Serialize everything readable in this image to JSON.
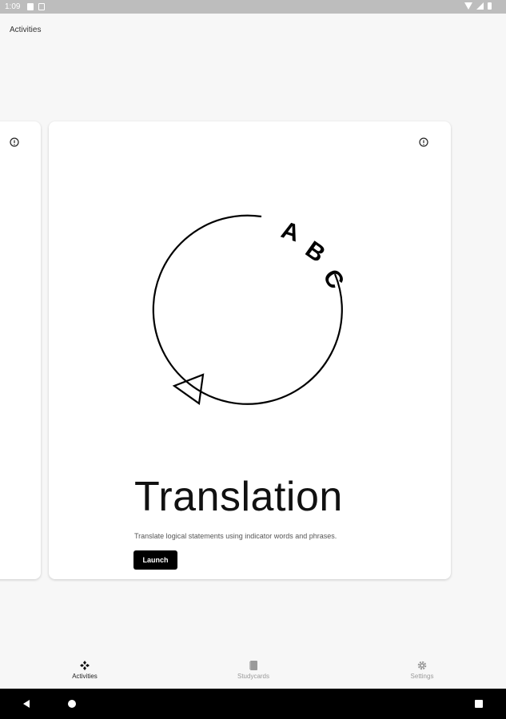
{
  "status_bar": {
    "time": "1:09"
  },
  "header": {
    "title": "Activities"
  },
  "activity": {
    "title": "Translation",
    "description": "Translate logical statements using indicator words and phrases.",
    "launch_label": "Launch",
    "illustration_text": [
      "A",
      "B",
      "C"
    ]
  },
  "bottom_nav": {
    "items": [
      {
        "label": "Activities",
        "icon": "activities-icon",
        "active": true
      },
      {
        "label": "Studycards",
        "icon": "studycards-icon",
        "active": false
      },
      {
        "label": "Settings",
        "icon": "gear-icon",
        "active": false
      }
    ]
  },
  "system_nav": {
    "buttons": [
      "back-icon",
      "home-icon",
      "recents-icon"
    ]
  },
  "colors": {
    "background": "#f7f7f7",
    "card": "#ffffff",
    "accent": "#000000",
    "status_bar": "#bdbdbd"
  }
}
